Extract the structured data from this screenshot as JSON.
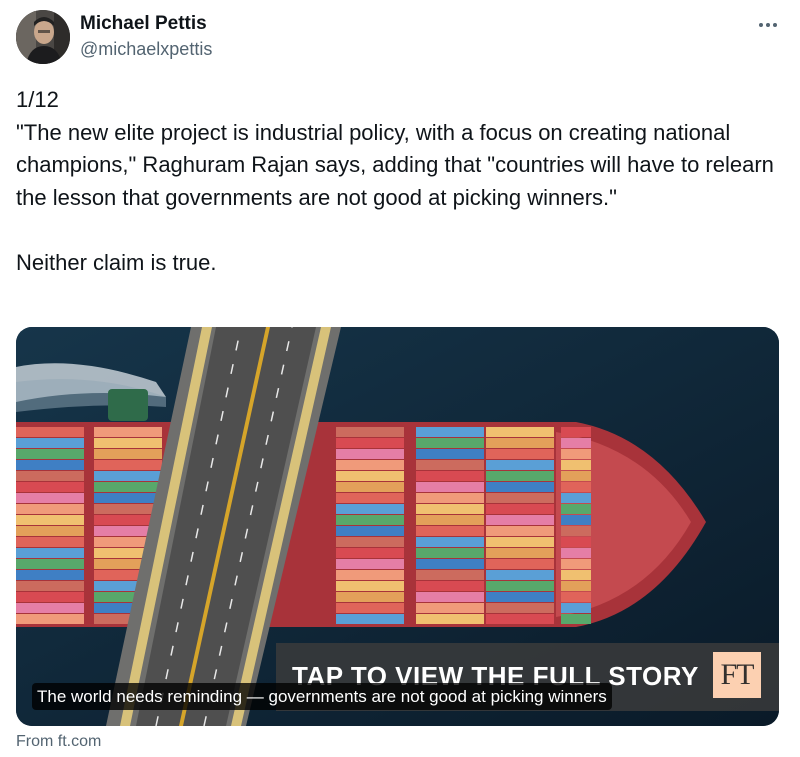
{
  "author": {
    "display_name": "Michael Pettis",
    "handle": "@michaelxpettis"
  },
  "tweet": {
    "line1": "1/12",
    "paragraph1": "\"The new elite project is industrial policy, with a focus on creating national champions,\" Raghuram Rajan says, adding that \"countries will have to relearn the lesson that governments are not good at picking winners.\"",
    "paragraph2": "Neither claim is true."
  },
  "card": {
    "banner_text": "TAP TO VIEW THE FULL STORY",
    "brand_logo": "FT",
    "title": "The world needs reminding — governments are not good at picking winners",
    "source": "From ft.com"
  },
  "icons": {
    "more": "more-horizontal-icon"
  },
  "colors": {
    "text": "#0f1419",
    "secondary_text": "#536471",
    "ft_pink": "#fcd0b1"
  }
}
